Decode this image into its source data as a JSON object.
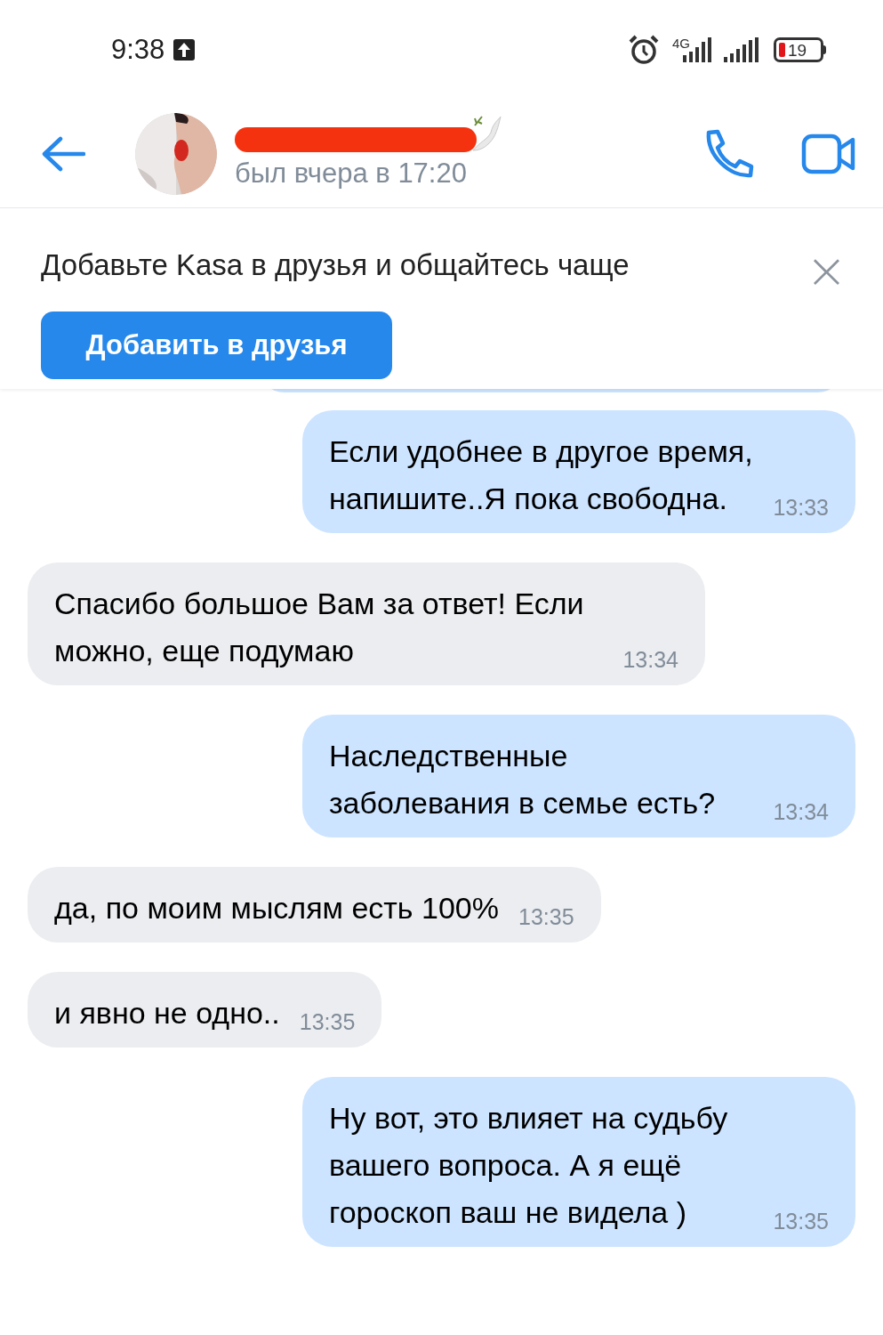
{
  "status_bar": {
    "time": "9:38",
    "network": "4G",
    "battery": "19"
  },
  "header": {
    "last_seen": "был вчера в 17:20"
  },
  "banner": {
    "text": "Добавьте Kasa в друзья и общайтесь чаще",
    "button": "Добавить в друзья",
    "close": "×"
  },
  "messages": [
    {
      "kind": "outgoing",
      "text": "Если удобнее в другое время, напишите..Я пока свободна.",
      "time": "13:33"
    },
    {
      "kind": "incoming",
      "text": "Спасибо большое Вам за ответ! Если можно, еще подумаю",
      "time": "13:34"
    },
    {
      "kind": "outgoing",
      "text": "Наследственные заболевания в семье есть?",
      "time": "13:34"
    },
    {
      "kind": "incoming",
      "text": "да, по моим мыслям есть 100%",
      "time": "13:35"
    },
    {
      "kind": "incoming",
      "text": "и явно не одно..",
      "time": "13:35"
    },
    {
      "kind": "outgoing",
      "text": "Ну вот, это влияет на судьбу вашего вопроса. А я ещё гороскоп ваш не видела )",
      "time": "13:35"
    }
  ]
}
